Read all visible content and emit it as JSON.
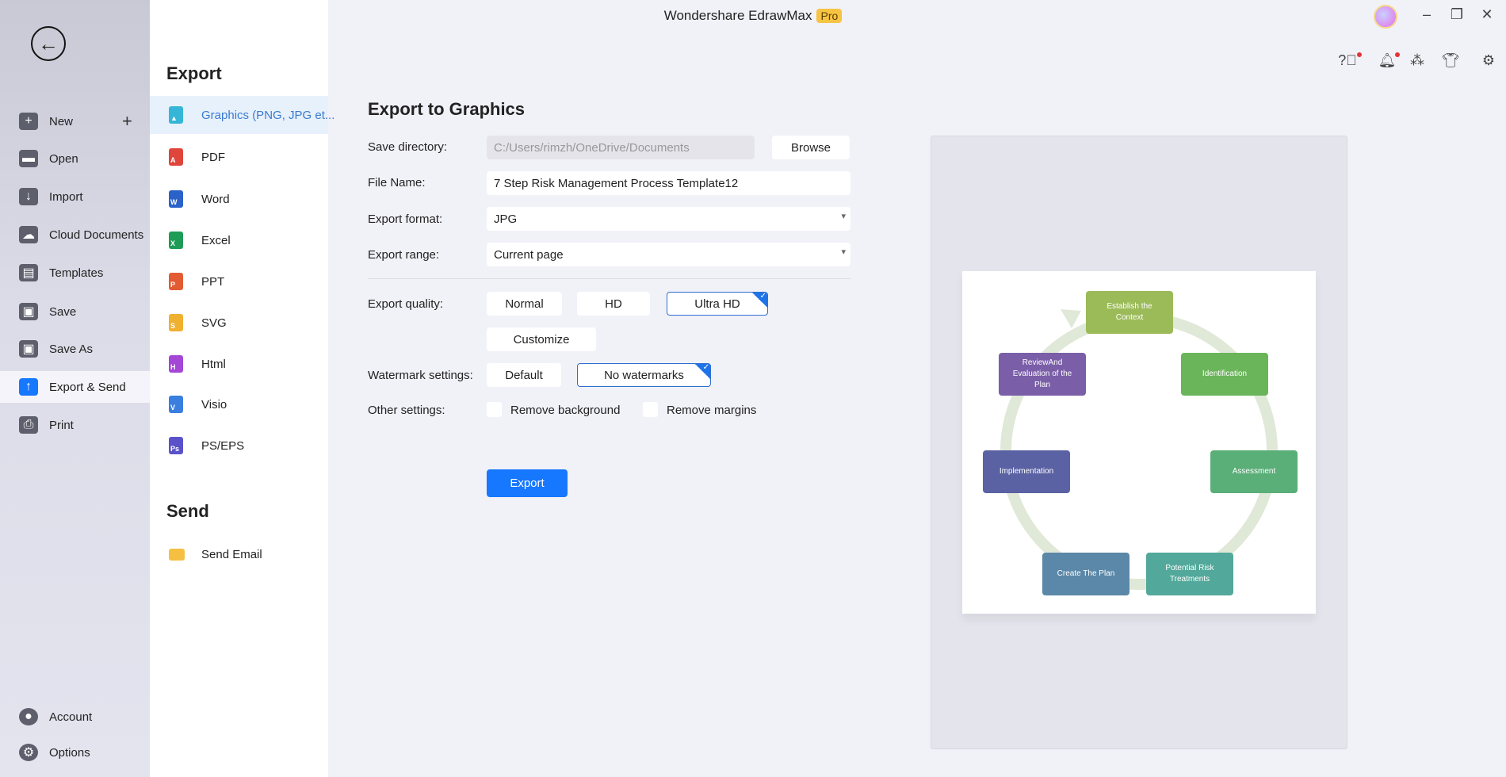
{
  "app": {
    "title": "Wondershare EdrawMax",
    "badge": "Pro"
  },
  "sidebar": {
    "items": [
      {
        "label": "New",
        "icon": "plus-square-icon"
      },
      {
        "label": "Open",
        "icon": "folder-icon"
      },
      {
        "label": "Import",
        "icon": "import-icon"
      },
      {
        "label": "Cloud Documents",
        "icon": "cloud-icon"
      },
      {
        "label": "Templates",
        "icon": "templates-icon"
      },
      {
        "label": "Save",
        "icon": "save-icon"
      },
      {
        "label": "Save As",
        "icon": "save-as-icon"
      },
      {
        "label": "Export & Send",
        "icon": "export-icon",
        "active": true
      },
      {
        "label": "Print",
        "icon": "print-icon"
      }
    ],
    "bottom": [
      {
        "label": "Account",
        "icon": "account-icon"
      },
      {
        "label": "Options",
        "icon": "gear-icon"
      }
    ]
  },
  "export_panel": {
    "heading": "Export",
    "items": [
      {
        "label": "Graphics (PNG, JPG et...",
        "color": "#35b6d6",
        "glyph": "▲"
      },
      {
        "label": "PDF",
        "color": "#e0453c",
        "glyph": "A"
      },
      {
        "label": "Word",
        "color": "#2b62c9",
        "glyph": "W"
      },
      {
        "label": "Excel",
        "color": "#1e9b55",
        "glyph": "X"
      },
      {
        "label": "PPT",
        "color": "#e35b32",
        "glyph": "P"
      },
      {
        "label": "SVG",
        "color": "#f0b030",
        "glyph": "S"
      },
      {
        "label": "Html",
        "color": "#a446d6",
        "glyph": "H"
      },
      {
        "label": "Visio",
        "color": "#3a7ee0",
        "glyph": "V"
      },
      {
        "label": "PS/EPS",
        "color": "#5a52c9",
        "glyph": "Ps"
      }
    ],
    "send_heading": "Send",
    "send_items": [
      {
        "label": "Send Email",
        "color": "#f5c042"
      }
    ]
  },
  "form": {
    "heading": "Export to Graphics",
    "save_directory": {
      "label": "Save directory:",
      "value": "C:/Users/rimzh/OneDrive/Documents",
      "browse": "Browse"
    },
    "file_name": {
      "label": "File Name:",
      "value": "7 Step Risk Management Process Template12"
    },
    "export_format": {
      "label": "Export format:",
      "value": "JPG"
    },
    "export_range": {
      "label": "Export range:",
      "value": "Current page"
    },
    "quality": {
      "label": "Export quality:",
      "options": [
        "Normal",
        "HD",
        "Ultra HD"
      ],
      "selected": "Ultra HD",
      "customize": "Customize"
    },
    "watermark": {
      "label": "Watermark settings:",
      "options": [
        "Default",
        "No watermarks"
      ],
      "selected": "No watermarks"
    },
    "other": {
      "label": "Other settings:",
      "remove_background": "Remove background",
      "remove_margins": "Remove margins",
      "remove_background_checked": false,
      "remove_margins_checked": false
    },
    "export_button": "Export"
  },
  "preview": {
    "nodes": [
      {
        "text": "Establish the Context",
        "color": "#9bbb59"
      },
      {
        "text": "Identification",
        "color": "#6ab55a"
      },
      {
        "text": "Assessment",
        "color": "#5aae78"
      },
      {
        "text": "Potential Risk Treatments",
        "color": "#52a89a"
      },
      {
        "text": "Create The Plan",
        "color": "#5b88a8"
      },
      {
        "text": "Implementation",
        "color": "#5b62a3"
      },
      {
        "text": "ReviewAnd Evaluation of the Plan",
        "color": "#7a5ea8"
      }
    ]
  },
  "colors": {
    "accent": "#1677ff",
    "notification": "#e53333"
  }
}
